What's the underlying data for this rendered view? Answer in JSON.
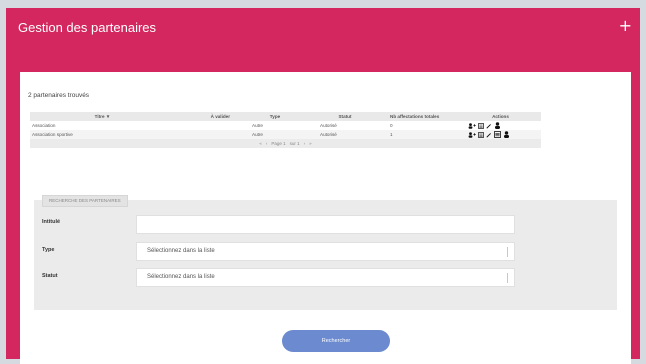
{
  "header": {
    "title": "Gestion des partenaires",
    "add_glyph": "+"
  },
  "summary": {
    "count_text": "2 partenaires trouvés"
  },
  "table": {
    "columns": [
      "Titre ▼",
      "À valider",
      "Type",
      "Statut",
      "Nb affectations totales",
      "Actions"
    ],
    "rows": [
      {
        "titre": "Association",
        "a_valider": "",
        "type": "Autre",
        "statut": "Autorisé",
        "nb": "0"
      },
      {
        "titre": "Association sportive",
        "a_valider": "",
        "type": "Autre",
        "statut": "Autorisé",
        "nb": "1"
      }
    ],
    "pager": {
      "first": "«",
      "prev": "‹",
      "page_label": "Page 1",
      "of_label": "sur 1",
      "next": "›",
      "last": "»"
    }
  },
  "search": {
    "tab_label": "Recherche des partenaires",
    "fields": {
      "intitule": {
        "label": "Intitulé",
        "value": ""
      },
      "type": {
        "label": "Type",
        "value": "Sélectionnez dans la liste"
      },
      "statut": {
        "label": "Statut",
        "value": "Sélectionnez dans la liste"
      }
    }
  },
  "actions": {
    "search_button": "Rechercher"
  },
  "colors": {
    "brand": "#d4275f",
    "button": "#6b8ad0",
    "panel": "#ebebeb"
  }
}
